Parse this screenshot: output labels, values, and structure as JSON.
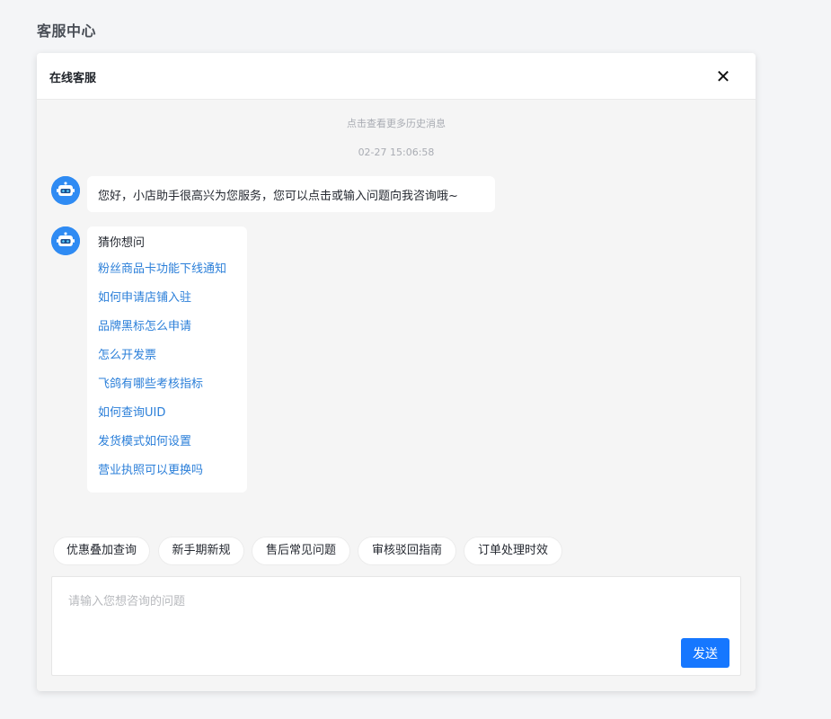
{
  "page": {
    "heading": "客服中心"
  },
  "panel": {
    "title": "在线客服",
    "close_icon": "close-icon",
    "history_link": "点击查看更多历史消息",
    "timestamp": "02-27 15:06:58"
  },
  "messages": {
    "avatar_icon": "robot-icon",
    "greeting": "您好，小店助手很高兴为您服务，您可以点击或输入问题向我咨询哦~",
    "faq": {
      "heading": "猜你想问",
      "items": [
        "粉丝商品卡功能下线通知",
        "如何申请店铺入驻",
        "品牌黑标怎么申请",
        "怎么开发票",
        "飞鸽有哪些考核指标",
        "如何查询UID",
        "发货模式如何设置",
        "营业执照可以更换吗"
      ]
    }
  },
  "quick_chips": [
    "优惠叠加查询",
    "新手期新规",
    "售后常见问题",
    "审核驳回指南",
    "订单处理时效"
  ],
  "composer": {
    "placeholder": "请输入您想咨询的问题",
    "value": "",
    "send_label": "发送"
  },
  "colors": {
    "accent": "#1677ff",
    "link": "#2b7fd9",
    "avatar": "#2f8bf3",
    "page_bg": "#f4f5f7"
  }
}
